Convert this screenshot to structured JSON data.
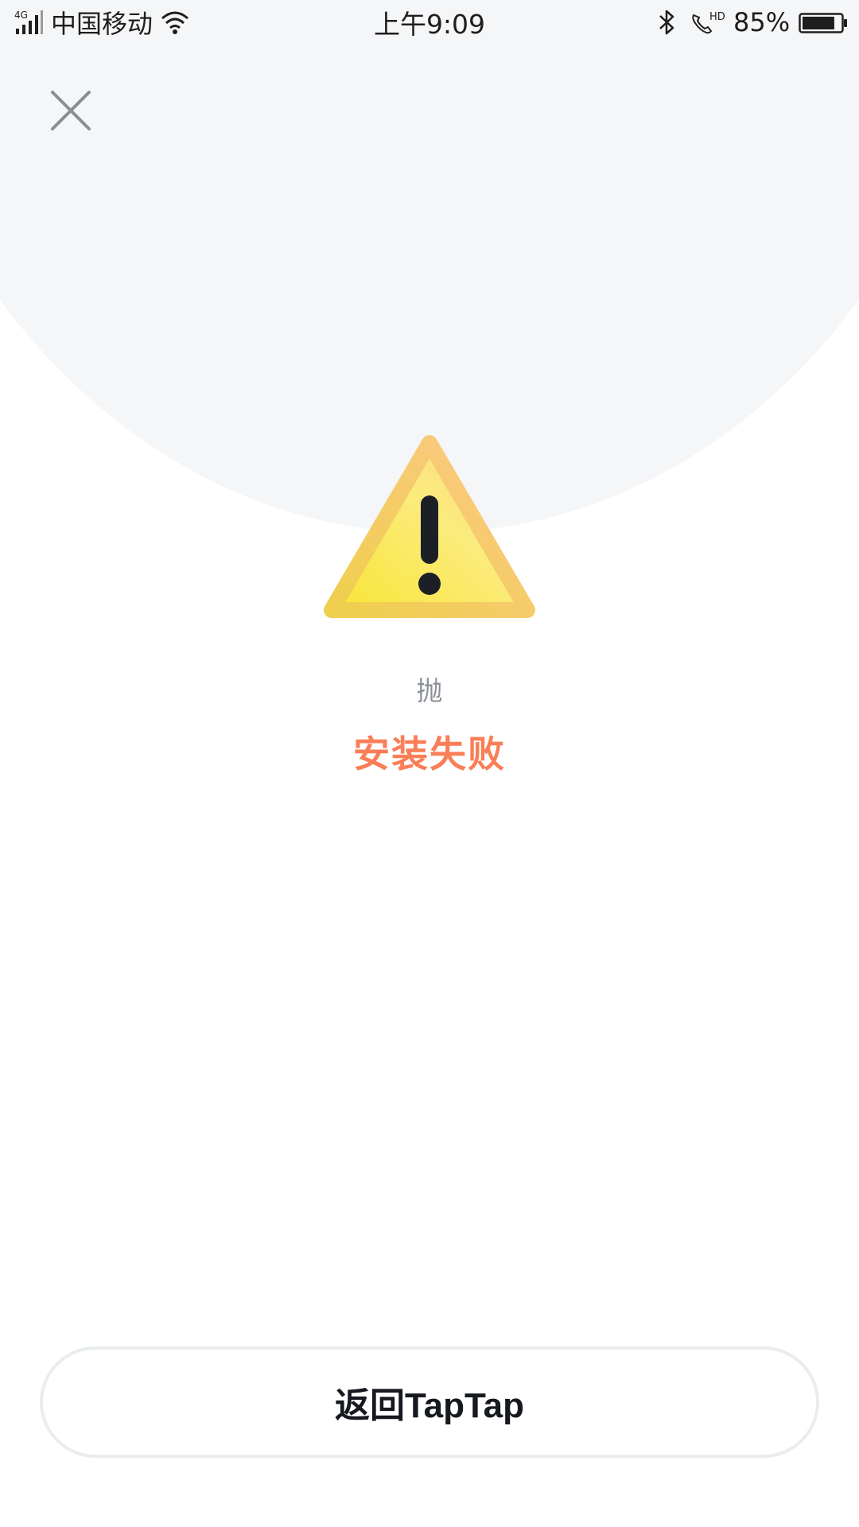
{
  "status_bar": {
    "network_type": "4G",
    "carrier": "中国移动",
    "time": "上午9:09",
    "hd_label": "HD",
    "battery_percent": "85%",
    "battery_level": 0.85,
    "icons": [
      "signal-icon",
      "wifi-icon",
      "bluetooth-icon",
      "hd-call-icon",
      "battery-icon"
    ]
  },
  "header": {
    "close_icon": "close-icon"
  },
  "result": {
    "icon": "warning-icon",
    "app_name": "抛",
    "status_text": "安装失败",
    "status_color": "#fa7e57"
  },
  "footer": {
    "back_button_label": "返回TapTap"
  },
  "colors": {
    "header_bg": "#f5f6f8",
    "warning_yellow": "#f7e64a",
    "warning_orange": "#fbcc80",
    "text_dark": "#16191f"
  }
}
